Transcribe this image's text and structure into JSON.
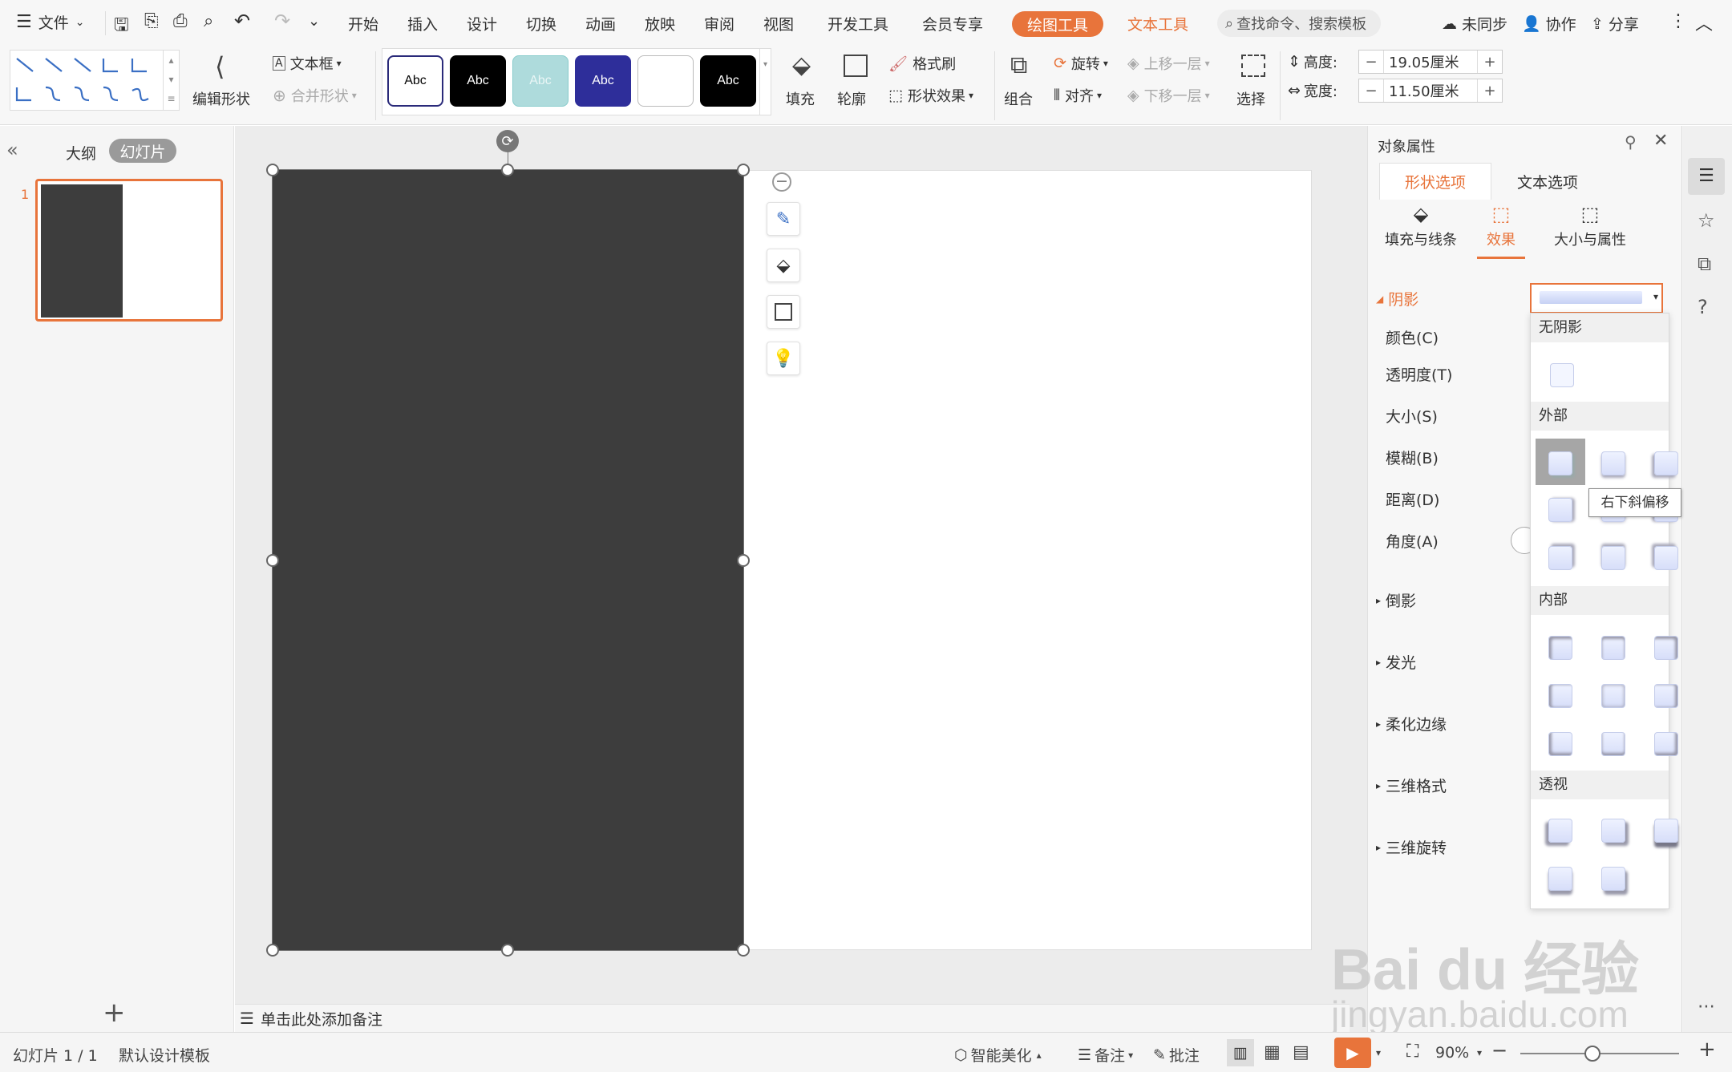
{
  "menu": {
    "file": "文件",
    "tabs": [
      "开始",
      "插入",
      "设计",
      "切换",
      "动画",
      "放映",
      "审阅",
      "视图",
      "开发工具",
      "会员专享"
    ],
    "drawing_tool": "绘图工具",
    "text_tool": "文本工具",
    "search": "查找命令、搜索模板",
    "sync": "未同步",
    "collab": "协作",
    "share": "分享"
  },
  "ribbon": {
    "edit_shape": "编辑形状",
    "textbox": "文本框",
    "merge_shape": "合并形状",
    "style_label": "Abc",
    "fill": "填充",
    "outline": "轮廓",
    "format_painter": "格式刷",
    "shape_effect": "形状效果",
    "group": "组合",
    "rotate": "旋转",
    "align": "对齐",
    "bring_forward": "上移一层",
    "send_backward": "下移一层",
    "select": "选择",
    "height_label": "高度:",
    "height_value": "19.05厘米",
    "width_label": "宽度:",
    "width_value": "11.50厘米"
  },
  "left": {
    "outline_tab": "大纲",
    "slides_tab": "幻灯片",
    "slide_number": "1"
  },
  "notes": "单击此处添加备注",
  "panel": {
    "title": "对象属性",
    "tab_shape": "形状选项",
    "tab_text": "文本选项",
    "sub_fill": "填充与线条",
    "sub_effect": "效果",
    "sub_size": "大小与属性",
    "shadow": "阴影",
    "props": [
      "颜色(C)",
      "透明度(T)",
      "大小(S)",
      "模糊(B)",
      "距离(D)",
      "角度(A)"
    ],
    "sections": [
      "倒影",
      "发光",
      "柔化边缘",
      "三维格式",
      "三维旋转"
    ]
  },
  "dropdown": {
    "none": "无阴影",
    "outer": "外部",
    "inner": "内部",
    "perspective": "透视",
    "tooltip": "右下斜偏移"
  },
  "status": {
    "slide": "幻灯片 1 / 1",
    "template": "默认设计模板",
    "beautify": "智能美化",
    "notes": "备注",
    "comment": "批注",
    "zoom": "90%"
  },
  "watermark": {
    "brand": "Bai du 经验",
    "url": "jingyan.baidu.com"
  },
  "colors": {
    "accent": "#e8743b",
    "shape": "#3d3d3d",
    "drawing_tab_bg": "#e8743b"
  }
}
